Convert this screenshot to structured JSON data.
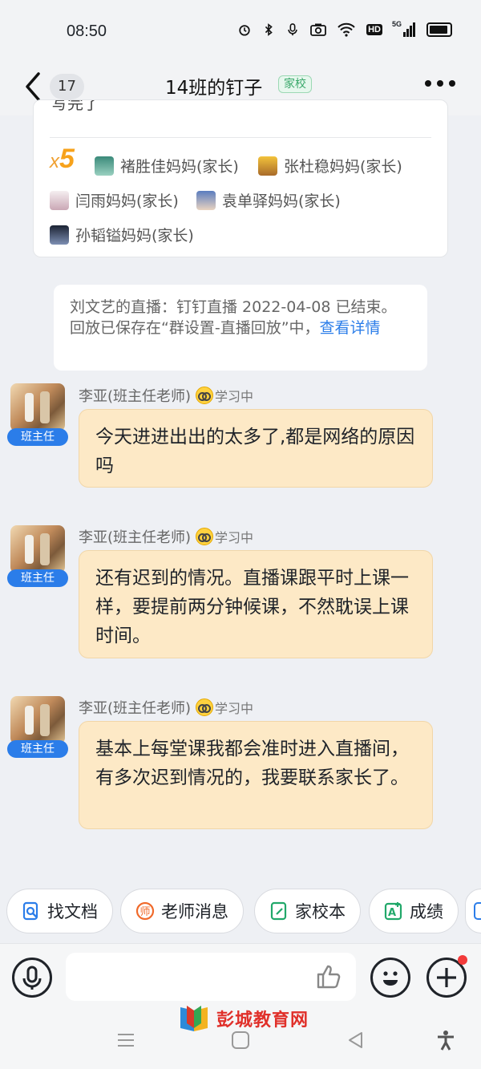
{
  "status_bar": {
    "time": "08:50",
    "network": "5G",
    "hd": "HD"
  },
  "header": {
    "back_count": "17",
    "title": "14班的钉子",
    "tag": "家校"
  },
  "reactions": {
    "cut_text": "写完了",
    "count_prefix": "x",
    "count": "5",
    "people": [
      "褚胜佳妈妈(家长)",
      "张杜稳妈妈(家长)",
      "闫雨妈妈(家长)",
      "袁单驿妈妈(家长)",
      "孙韬镒妈妈(家长)"
    ]
  },
  "notice": {
    "text": "刘文艺的直播：钉钉直播 2022-04-08 已结束。回放已保存在“群设置-直播回放”中，",
    "link": "查看详情"
  },
  "messages": [
    {
      "sender": "李亚(班主任老师)",
      "status": "学习中",
      "role": "班主任",
      "text": "今天进进出出的太多了,都是网络的原因吗"
    },
    {
      "sender": "李亚(班主任老师)",
      "status": "学习中",
      "role": "班主任",
      "text": "还有迟到的情况。直播课跟平时上课一样，要提前两分钟候课，不然耽误上课时间。"
    },
    {
      "sender": "李亚(班主任老师)",
      "status": "学习中",
      "role": "班主任",
      "text": "基本上每堂课我都会准时进入直播间，有多次迟到情况的，我要联系家长了。"
    }
  ],
  "quick_actions": [
    {
      "label": "找文档",
      "icon": "doc-search-icon",
      "color": "#2b7de9"
    },
    {
      "label": "老师消息",
      "icon": "teacher-icon",
      "color": "#f06a2b"
    },
    {
      "label": "家校本",
      "icon": "notebook-icon",
      "color": "#21a86a"
    },
    {
      "label": "成绩",
      "icon": "score-icon",
      "color": "#21a86a"
    }
  ],
  "watermark": {
    "text": "彭城教育网"
  }
}
